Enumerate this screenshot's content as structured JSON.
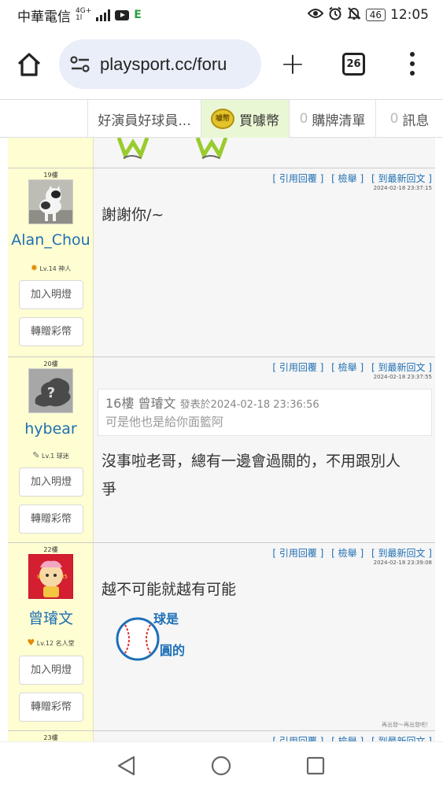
{
  "status_bar": {
    "carrier": "中華電信",
    "network": "4G+",
    "signal_sub": "1l",
    "battery": "46",
    "time": "12:05",
    "icons": [
      "signal-icon",
      "youtube-icon",
      "e-app-icon",
      "eye-icon",
      "alarm-icon",
      "bell-off-icon",
      "battery-icon"
    ]
  },
  "browser": {
    "url": "playsport.cc/foru",
    "tab_count": "26",
    "icons": [
      "home-icon",
      "site-settings-icon",
      "new-tab-icon",
      "tabs-icon",
      "more-icon"
    ]
  },
  "site_tabs": [
    {
      "label": "好演員好球員..."
    },
    {
      "label": "買噱幣",
      "coin_text": "噱幣"
    },
    {
      "count": "0",
      "label": "購牌清單"
    },
    {
      "count": "0",
      "label": "訊息"
    }
  ],
  "action_links": {
    "quote": "[ 引用回覆 ]",
    "report": "[ 檢舉 ]",
    "latest": "[ 到最新回文 ]"
  },
  "sidebar_buttons": {
    "light": "加入明燈",
    "gift": "轉贈彩幣"
  },
  "posts": [
    {
      "floor": "19樓",
      "username": "Alan_Chou",
      "level": "Lv.14 神人",
      "time": "2024-02-18 23:37:15",
      "content": "謝謝你/~"
    },
    {
      "floor": "20樓",
      "username": "hybear",
      "level": "Lv.1 球迷",
      "time": "2024-02-18 23:37:55",
      "quote": {
        "floor": "16樓",
        "author": "曾璿文",
        "posted_prefix": "發表於",
        "posted_at": "2024-02-18 23:36:56",
        "text": "可是他也是給你面籃阿"
      },
      "content_line1": "沒事啦老哥，總有一邊會過關的，不用跟別人",
      "content_line2": "爭"
    },
    {
      "floor": "22樓",
      "username": "曾璿文",
      "level": "Lv.12 名人堂",
      "time": "2024-02-18 23:39:08",
      "content": "越不可能就越有可能",
      "sticker_text_1": "球是",
      "sticker_text_2": "圓的",
      "avatar_text_1": "80",
      "avatar_text_2": "85",
      "note": "再出發～再出發吧！"
    },
    {
      "floor": "23樓"
    }
  ]
}
